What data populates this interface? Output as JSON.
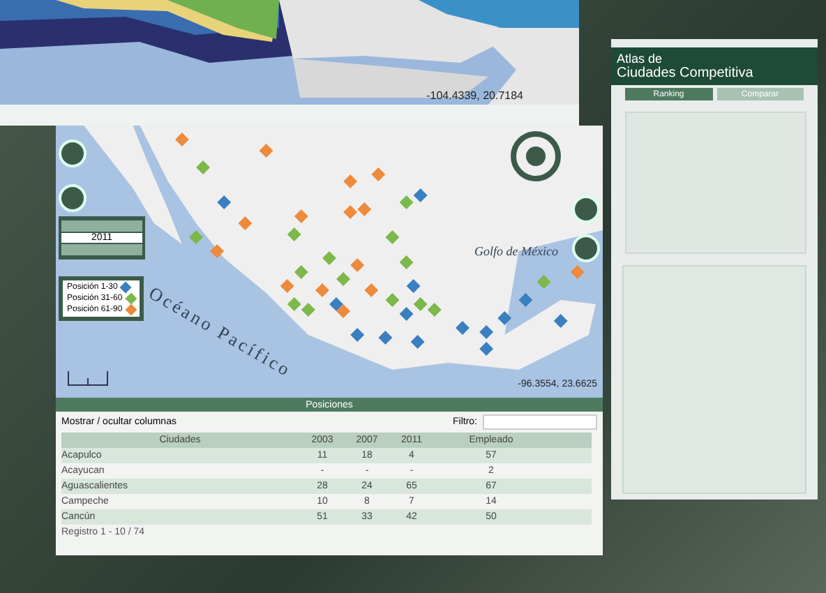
{
  "top_map": {
    "coordinates": "-104.4339, 20.7184"
  },
  "sidebar": {
    "title_line_1": "Atlas de",
    "title_line_2": "Ciudades Competitiva",
    "tabs": [
      {
        "label": "Ranking",
        "selected": true
      },
      {
        "label": "Comparar",
        "selected": false
      }
    ]
  },
  "map": {
    "gulf_label": "Golfo de México",
    "ocean_label": "Océano Pacífico",
    "coordinates": "-96.3554, 23.6625",
    "year": "2011",
    "legend": [
      {
        "label": "Posición 1-30",
        "color": "#3a7fc0"
      },
      {
        "label": "Posición 31-60",
        "color": "#7cb84a"
      },
      {
        "label": "Posición 61-90",
        "color": "#ee8a3c"
      }
    ]
  },
  "table": {
    "title": "Posiciones",
    "columns_toggle": "Mostrar / ocultar columnas",
    "filter_label": "Filtro:",
    "columns": [
      "Ciudades",
      "2003",
      "2007",
      "2011",
      "Empleado"
    ],
    "rows": [
      [
        "Acapulco",
        "11",
        "18",
        "4",
        "57"
      ],
      [
        "Acayucan",
        "-",
        "-",
        "-",
        "2"
      ],
      [
        "Aguascalientes",
        "28",
        "24",
        "65",
        "67"
      ],
      [
        "Campeche",
        "10",
        "8",
        "7",
        "14"
      ],
      [
        "Cancún",
        "51",
        "33",
        "42",
        "50"
      ]
    ],
    "footer": "Registro 1 - 10 / 74"
  }
}
